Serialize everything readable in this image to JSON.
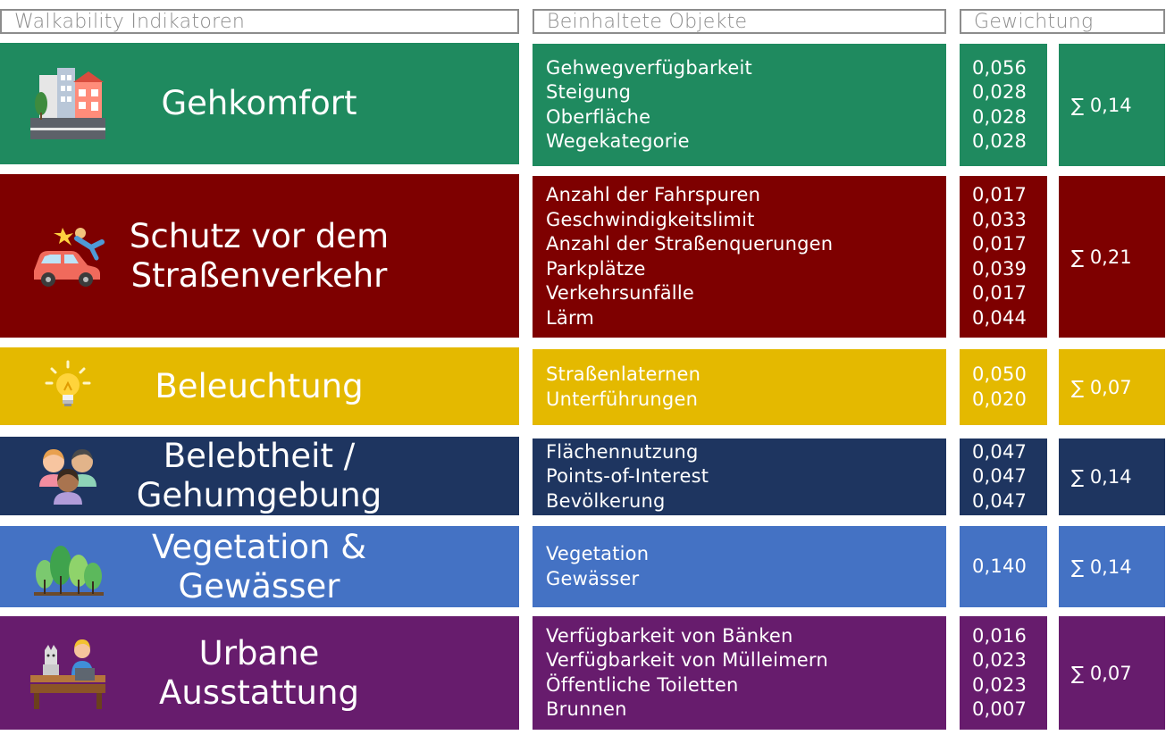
{
  "headers": {
    "indicators": "Walkability Indikatoren",
    "objects": "Beinhaltete Objekte",
    "weighting": "Gewichtung"
  },
  "colors": {
    "gehkomfort": "#1f8a5f",
    "schutz": "#7e0000",
    "beleuchtung": "#e4b900",
    "belebtheit": "#1e3560",
    "vegetation": "#4472c4",
    "urbane": "#671c6d",
    "header_border": "#8c8c8c"
  },
  "rows": [
    {
      "title_lines": [
        "Gehkomfort"
      ],
      "icon": "street-buildings-icon",
      "objects": [
        "Gehwegverfügbarkeit",
        "Steigung",
        "Oberfläche",
        "Wegekategorie"
      ],
      "weights": [
        "0,056",
        "0,028",
        "0,028",
        "0,028"
      ],
      "sum": "∑ 0,14"
    },
    {
      "title_lines": [
        "Schutz vor dem",
        "Straßenverkehr"
      ],
      "icon": "car-accident-icon",
      "objects": [
        "Anzahl der Fahrspuren",
        "Geschwindigkeitslimit",
        "Anzahl der Straßenquerungen",
        "Parkplätze",
        "Verkehrsunfälle",
        "Lärm"
      ],
      "weights": [
        "0,017",
        "0,033",
        "0,017",
        "0,039",
        "0,017",
        "0,044"
      ],
      "sum": "∑ 0,21"
    },
    {
      "title_lines": [
        "Beleuchtung"
      ],
      "icon": "light-bulb-icon",
      "objects": [
        "Straßenlaternen",
        "Unterführungen"
      ],
      "weights": [
        "0,050",
        "0,020"
      ],
      "sum": "∑ 0,07"
    },
    {
      "title_lines": [
        "Belebtheit /",
        "Gehumgebung"
      ],
      "icon": "people-group-icon",
      "objects": [
        "Flächennutzung",
        "Points-of-Interest",
        "Bevölkerung"
      ],
      "weights": [
        "0,047",
        "0,047",
        "0,047"
      ],
      "sum": "∑ 0,14"
    },
    {
      "title_lines": [
        "Vegetation &",
        "Gewässer"
      ],
      "icon": "trees-icon",
      "objects": [
        "Vegetation",
        "Gewässer"
      ],
      "weights": [
        "0,140"
      ],
      "sum": "∑ 0,14"
    },
    {
      "title_lines": [
        "Urbane",
        "Ausstattung"
      ],
      "icon": "bench-person-icon",
      "objects": [
        "Verfügbarkeit von Bänken",
        "Verfügbarkeit von Mülleimern",
        "Öffentliche Toiletten",
        "Brunnen"
      ],
      "weights": [
        "0,016",
        "0,023",
        "0,023",
        "0,007"
      ],
      "sum": "∑ 0,07"
    }
  ]
}
